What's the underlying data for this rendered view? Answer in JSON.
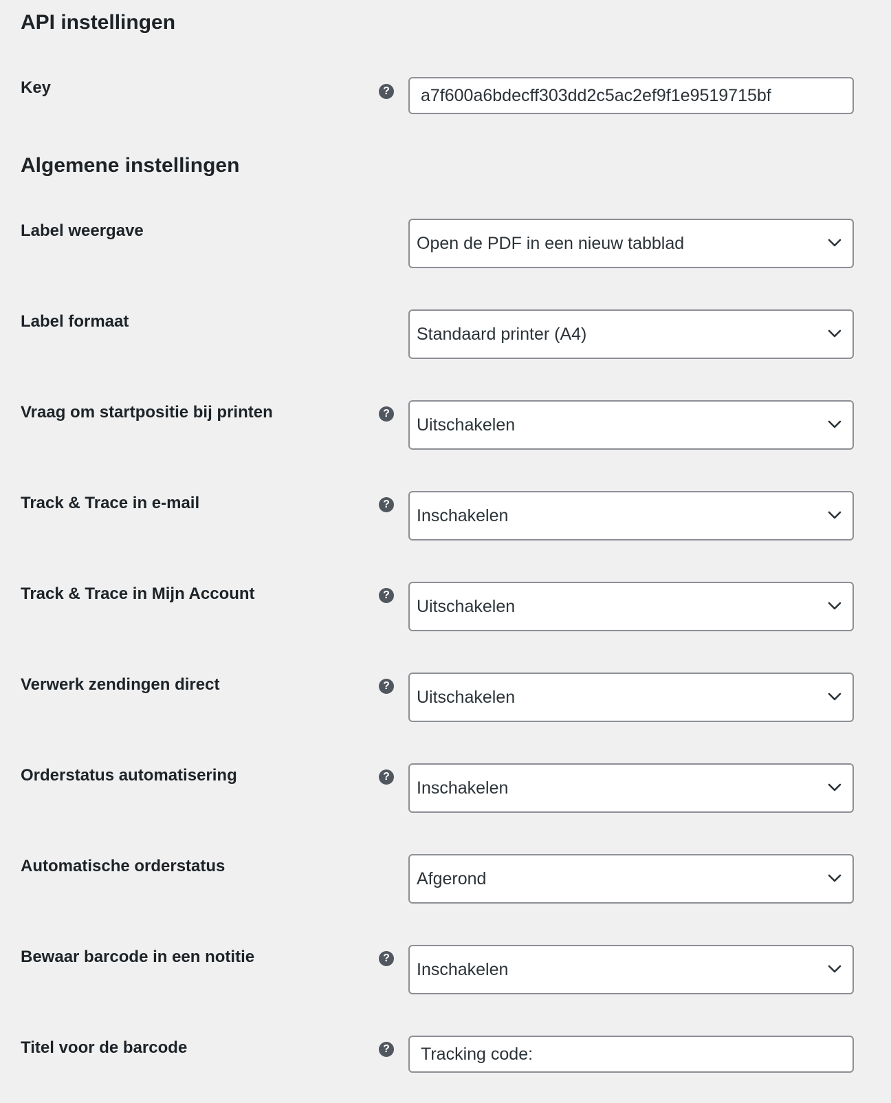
{
  "sections": {
    "api_title": "API instellingen",
    "general_title": "Algemene instellingen"
  },
  "icons": {
    "help": "?",
    "chevron": "chevron-down-icon"
  },
  "fields": {
    "key": {
      "label": "Key",
      "value": "a7f600a6bdecff303dd2c5ac2ef9f1e9519715bf"
    },
    "label_weergave": {
      "label": "Label weergave",
      "value": "Open de PDF in een nieuw tabblad"
    },
    "label_formaat": {
      "label": "Label formaat",
      "value": "Standaard printer (A4)"
    },
    "startpositie": {
      "label": "Vraag om startpositie bij printen",
      "value": "Uitschakelen"
    },
    "tt_email": {
      "label": "Track & Trace in e-mail",
      "value": "Inschakelen"
    },
    "tt_account": {
      "label": "Track & Trace in Mijn Account",
      "value": "Uitschakelen"
    },
    "verwerk": {
      "label": "Verwerk zendingen direct",
      "value": "Uitschakelen"
    },
    "orderstatus_auto": {
      "label": "Orderstatus automatisering",
      "value": "Inschakelen"
    },
    "auto_orderstatus": {
      "label": "Automatische orderstatus",
      "value": "Afgerond"
    },
    "barcode_notitie": {
      "label": "Bewaar barcode in een notitie",
      "value": "Inschakelen"
    },
    "barcode_titel": {
      "label": "Titel voor de barcode",
      "value": "Tracking code:"
    }
  },
  "colors": {
    "background": "#f0f0f1",
    "text": "#1d2327",
    "field_border": "#8c8f94",
    "help_icon": "#50575e"
  }
}
